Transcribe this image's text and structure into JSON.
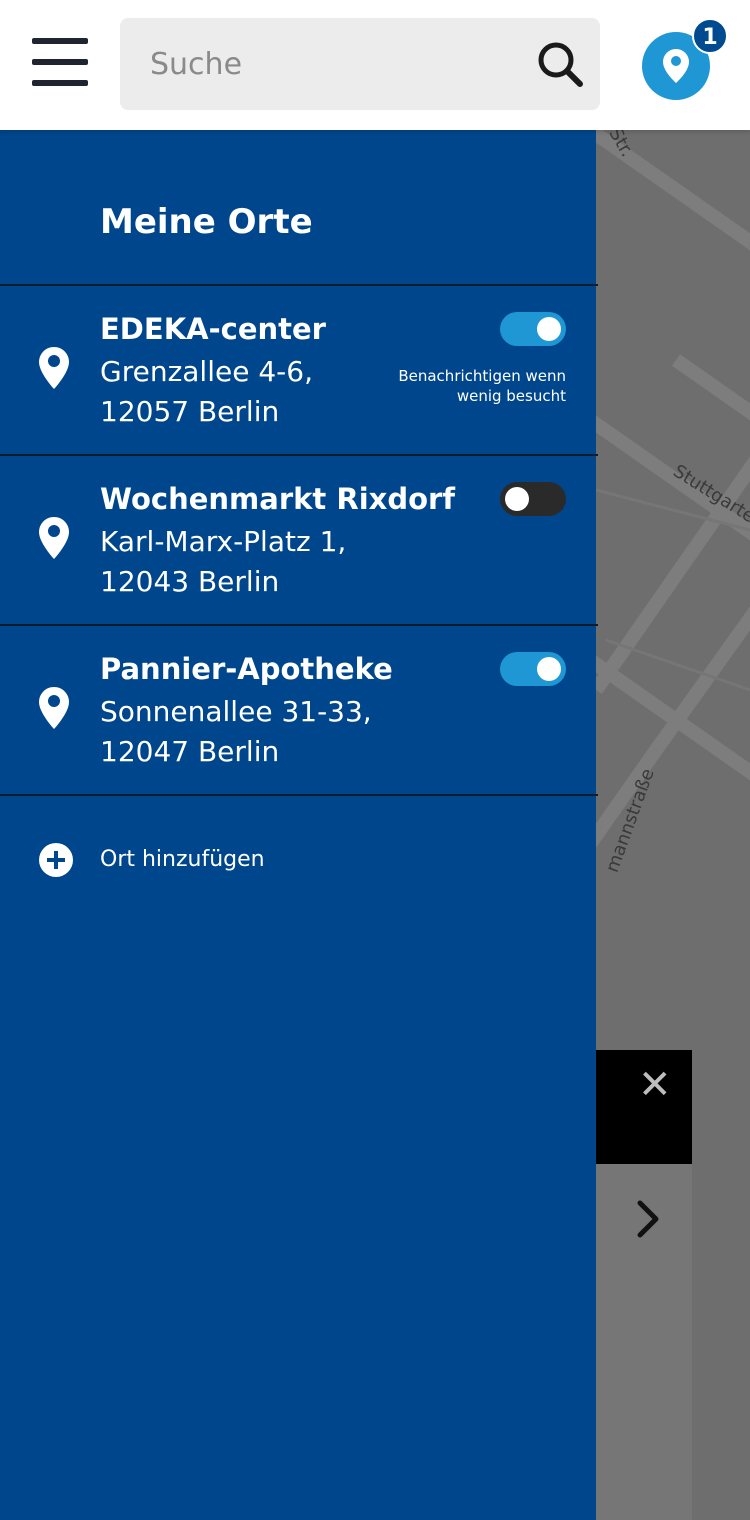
{
  "header": {
    "search_placeholder": "Suche",
    "location_badge_count": "1"
  },
  "drawer": {
    "title": "Meine Orte",
    "places": [
      {
        "name": "EDEKA-center",
        "address_line1": "Grenzallee 4-6,",
        "address_line2": "12057 Berlin",
        "notify_enabled": true,
        "notify_label_line1": "Benachrichtigen wenn",
        "notify_label_line2": "wenig besucht"
      },
      {
        "name": "Wochenmarkt Rixdorf",
        "address_line1": "Karl-Marx-Platz 1,",
        "address_line2": "12043 Berlin",
        "notify_enabled": false
      },
      {
        "name": "Pannier-Apotheke",
        "address_line1": "Sonnenallee 31-33,",
        "address_line2": "12047 Berlin",
        "notify_enabled": true
      }
    ],
    "add_place_label": "Ort hinzufügen"
  },
  "map": {
    "street_labels": [
      "Str.",
      "Stuttgarter S",
      "mannstraße"
    ]
  },
  "colors": {
    "drawer_bg": "#00468c",
    "accent": "#1f97d4",
    "badge": "#004a8f"
  }
}
